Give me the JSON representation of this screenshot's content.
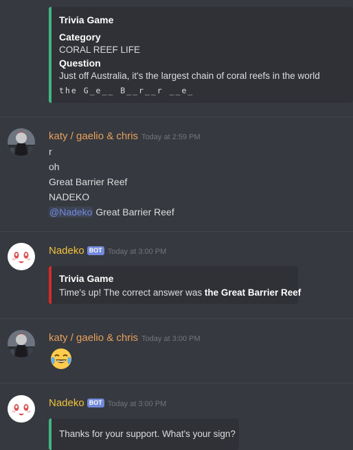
{
  "colors": {
    "background": "#36393f",
    "embed_bg": "#2f3136",
    "green_bar": "#43b581",
    "red_bar": "#d82a2a",
    "username_katy": "#e8a15c",
    "username_nadeko": "#f3c33c",
    "mention": "#7289da",
    "bot_tag": "#7289da"
  },
  "embed1": {
    "title": "Trivia Game",
    "category_label": "Category",
    "category_value": "CORAL REEF LIFE",
    "question_label": "Question",
    "question_value": "Just off Australia, it's the largest chain of coral reefs in the world",
    "hint": "the G_e__ B__r__r __e_"
  },
  "messages": [
    {
      "username": "katy / gaelio & chris",
      "timestamp": "Today at 2:59 PM",
      "avatar_icon": "katy-avatar-icon",
      "lines": [
        "r",
        "oh",
        "Great Barrier Reef",
        "NADEKO"
      ],
      "mention": "@Nadeko",
      "mention_rest": " Great Barrier Reef"
    },
    {
      "username": "Nadeko",
      "bot_tag": "BOT",
      "timestamp": "Today at 3:00 PM",
      "avatar_icon": "nadeko-avatar-icon",
      "embed": {
        "title": "Trivia Game",
        "text_prefix": "Time's up! The correct answer was ",
        "text_bold": "the Great Barrier Reef"
      }
    },
    {
      "username": "katy / gaelio & chris",
      "timestamp": "Today at 3:00 PM",
      "avatar_icon": "katy-avatar-icon",
      "emoji": "joy-emoji-icon"
    },
    {
      "username": "Nadeko",
      "bot_tag": "BOT",
      "timestamp": "Today at 3:00 PM",
      "avatar_icon": "nadeko-avatar-icon",
      "embed": {
        "text": "Thanks for your support. What's your sign?"
      }
    }
  ]
}
